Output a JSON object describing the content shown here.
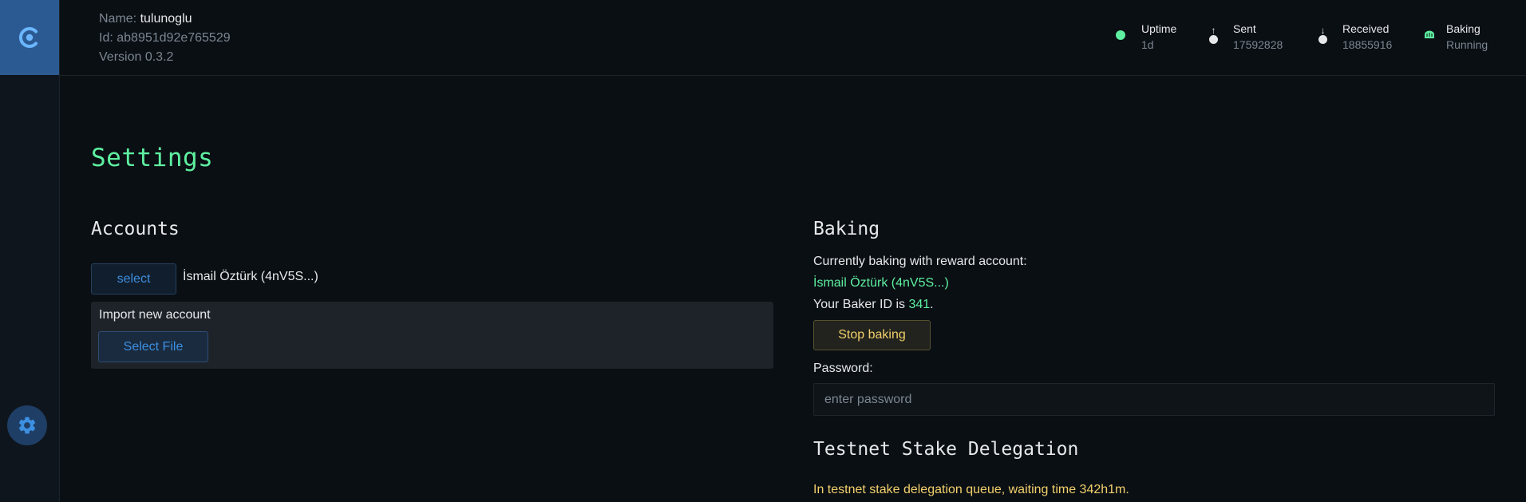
{
  "node": {
    "name_label": "Name:",
    "name_value": "tulunoglu",
    "id_label": "Id:",
    "id_value": "ab8951d92e765529",
    "version_label": "Version",
    "version_value": "0.3.2"
  },
  "stats": {
    "uptime": {
      "label": "Uptime",
      "value": "1d"
    },
    "sent": {
      "label": "Sent",
      "value": "17592828"
    },
    "received": {
      "label": "Received",
      "value": "18855916"
    },
    "baking": {
      "label": "Baking",
      "value": "Running"
    }
  },
  "page": {
    "title": "Settings"
  },
  "accounts": {
    "heading": "Accounts",
    "select_label": "select",
    "current_account": "İsmail Öztürk (4nV5S...)",
    "import_label": "Import new account",
    "select_file_label": "Select File"
  },
  "baking": {
    "heading": "Baking",
    "reward_text": "Currently baking with reward account:",
    "reward_account": "İsmail Öztürk (4nV5S...)",
    "baker_id_prefix": "Your Baker ID is ",
    "baker_id": "341",
    "baker_id_suffix": ".",
    "stop_label": "Stop baking",
    "password_label": "Password:",
    "password_placeholder": "enter password"
  },
  "delegation": {
    "heading": "Testnet Stake Delegation",
    "status": "In testnet stake delegation queue, waiting time 342h1m."
  },
  "colors": {
    "accent_green": "#5ef0a0",
    "accent_blue": "#3d8fe0",
    "warning_yellow": "#f2d06b",
    "logo_bg": "#2b5a92",
    "background": "#0a0f14"
  },
  "icons": {
    "logo": "concordium-logo-icon",
    "settings": "gear-icon",
    "uptime": "status-dot-icon",
    "sent": "arrow-up-icon",
    "received": "arrow-down-icon",
    "baking": "bread-icon"
  }
}
